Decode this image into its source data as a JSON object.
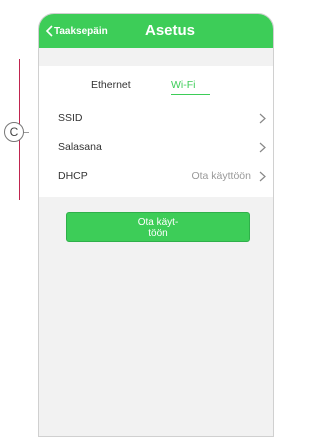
{
  "header": {
    "back_label": "Taaksepäin",
    "title": "Asetus"
  },
  "tabs": [
    {
      "label": "Ethernet",
      "active": false
    },
    {
      "label": "Wi-Fi",
      "active": true
    }
  ],
  "rows": [
    {
      "label": "SSID",
      "value": ""
    },
    {
      "label": "Salasana",
      "value": ""
    },
    {
      "label": "DHCP",
      "value": "Ota käyttöön"
    }
  ],
  "apply_button": {
    "line1": "Ota käyt-",
    "line2": "töön"
  },
  "callout": {
    "letter": "C"
  },
  "colors": {
    "accent": "#3dcd58",
    "callout_line": "#c0254f"
  }
}
